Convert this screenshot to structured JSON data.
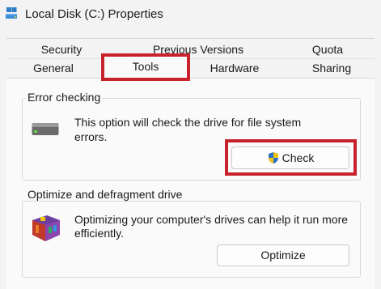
{
  "window": {
    "title": "Local Disk (C:) Properties",
    "icon": "drive-icon"
  },
  "tabs": {
    "row1": [
      "Security",
      "Previous Versions",
      "Quota"
    ],
    "row2": [
      "General",
      "Tools",
      "Hardware",
      "Sharing"
    ],
    "active": "Tools"
  },
  "error_checking": {
    "label": "Error checking",
    "line1": "This option will check the drive for file system",
    "line2": "errors.",
    "button": "Check",
    "icon": "hard-drive-icon",
    "button_icon": "shield-icon"
  },
  "optimize": {
    "label": "Optimize and defragment drive",
    "line1": "Optimizing your computer's drives can help it run more",
    "line2": "efficiently.",
    "button": "Optimize",
    "icon": "defrag-icon"
  },
  "colors": {
    "highlight": "#c8232c",
    "accent": "#0067c0"
  }
}
